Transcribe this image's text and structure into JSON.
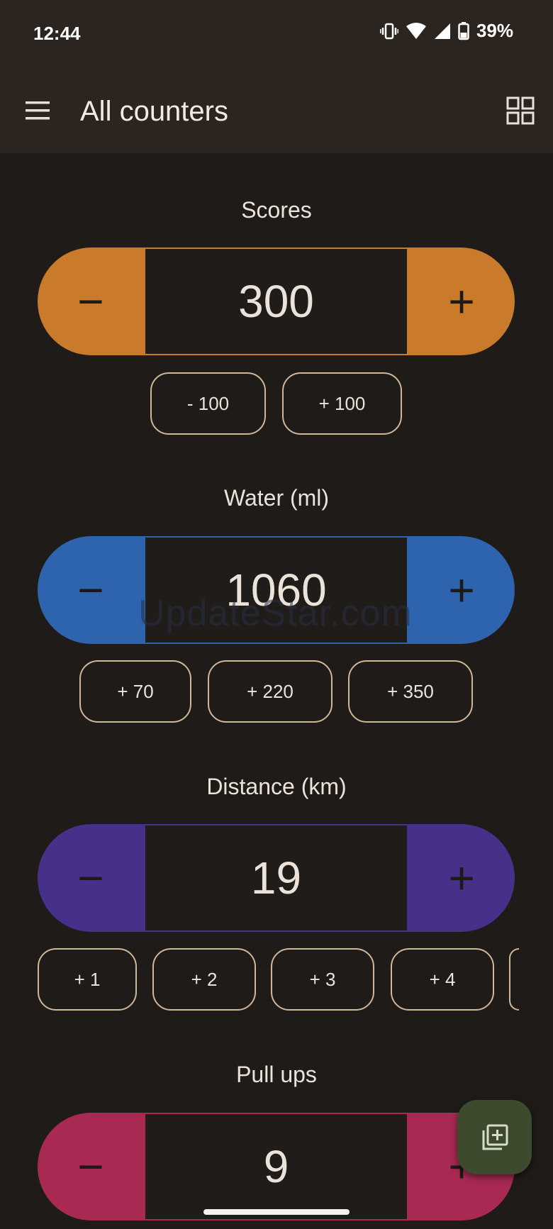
{
  "status_bar": {
    "time": "12:44",
    "battery": "39%"
  },
  "app_bar": {
    "title": "All counters"
  },
  "counters": [
    {
      "title": "Scores",
      "value": "300",
      "color": "#c97a2a",
      "minus_label": "−",
      "plus_label": "+",
      "quick": [
        "- 100",
        "+ 100"
      ]
    },
    {
      "title": "Water (ml)",
      "value": "1060",
      "color": "#2e63ae",
      "minus_label": "−",
      "plus_label": "+",
      "quick": [
        "+ 70",
        "+ 220",
        "+ 350"
      ]
    },
    {
      "title": "Distance (km)",
      "value": "19",
      "color": "#47308a",
      "minus_label": "−",
      "plus_label": "+",
      "quick": [
        "+ 1",
        "+ 2",
        "+ 3",
        "+ 4"
      ]
    },
    {
      "title": "Pull ups",
      "value": "9",
      "color": "#a82a53",
      "minus_label": "−",
      "plus_label": "+"
    }
  ],
  "watermark": "UpdateStar.com",
  "icons": {
    "menu": "menu-icon",
    "grid": "grid-view-icon",
    "fab": "add-counter-icon",
    "vibrate": "vibrate-icon",
    "wifi": "wifi-icon",
    "signal": "signal-icon",
    "battery": "battery-icon"
  }
}
